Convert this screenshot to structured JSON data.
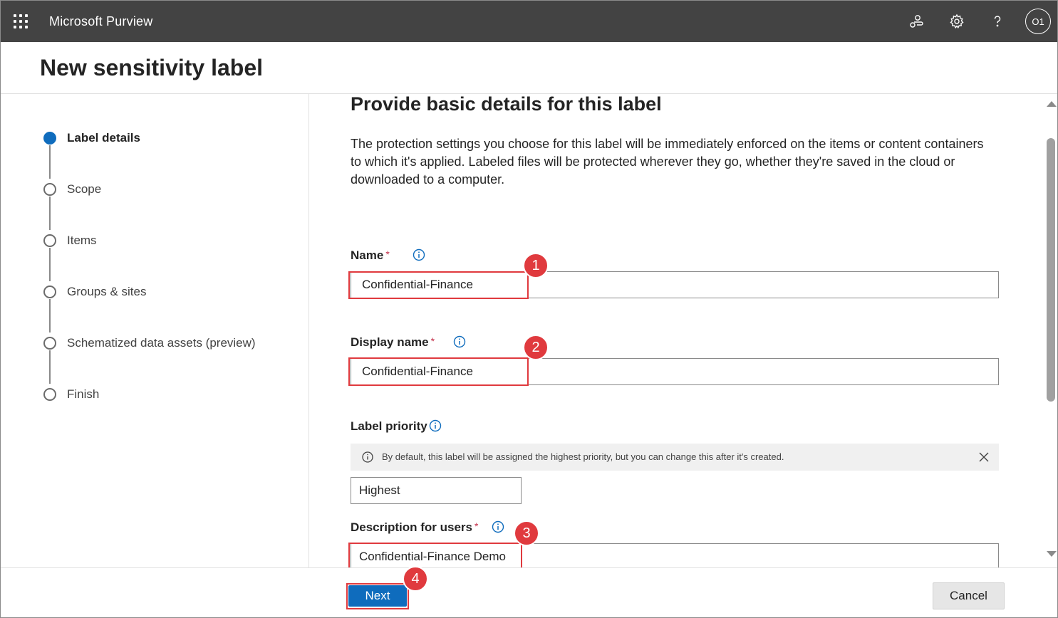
{
  "app": {
    "title": "Microsoft Purview",
    "user_initials": "O1"
  },
  "topbar_icons": [
    "waffle-icon",
    "connections-icon",
    "gear-icon",
    "help-icon"
  ],
  "page": {
    "title": "New sensitivity label"
  },
  "steps": [
    {
      "label": "Label details",
      "active": true
    },
    {
      "label": "Scope",
      "active": false
    },
    {
      "label": "Items",
      "active": false
    },
    {
      "label": "Groups & sites",
      "active": false
    },
    {
      "label": "Schematized data assets (preview)",
      "active": false
    },
    {
      "label": "Finish",
      "active": false
    }
  ],
  "main": {
    "heading": "Provide basic details for this label",
    "intro": "The protection settings you choose for this label will be immediately enforced on the items or content containers to which it's applied. Labeled files will be protected wherever they go, whether they're saved in the cloud or downloaded to a computer.",
    "name": {
      "label": "Name",
      "required_mark": "*",
      "value": "Confidential-Finance"
    },
    "display_name": {
      "label": "Display name",
      "required_mark": "*",
      "value": "Confidential-Finance"
    },
    "priority": {
      "label": "Label priority",
      "message": "By default, this label will be assigned the highest priority, but you can change this after it's created.",
      "value": "Highest"
    },
    "description": {
      "label": "Description for users",
      "required_mark": "*",
      "value": "Confidential-Finance Demo"
    }
  },
  "annotations": [
    "1",
    "2",
    "3",
    "4"
  ],
  "footer": {
    "next_label": "Next",
    "cancel_label": "Cancel"
  },
  "colors": {
    "topbar": "#434343",
    "accent": "#0f6cbd",
    "annotation": "#e03a3e"
  }
}
